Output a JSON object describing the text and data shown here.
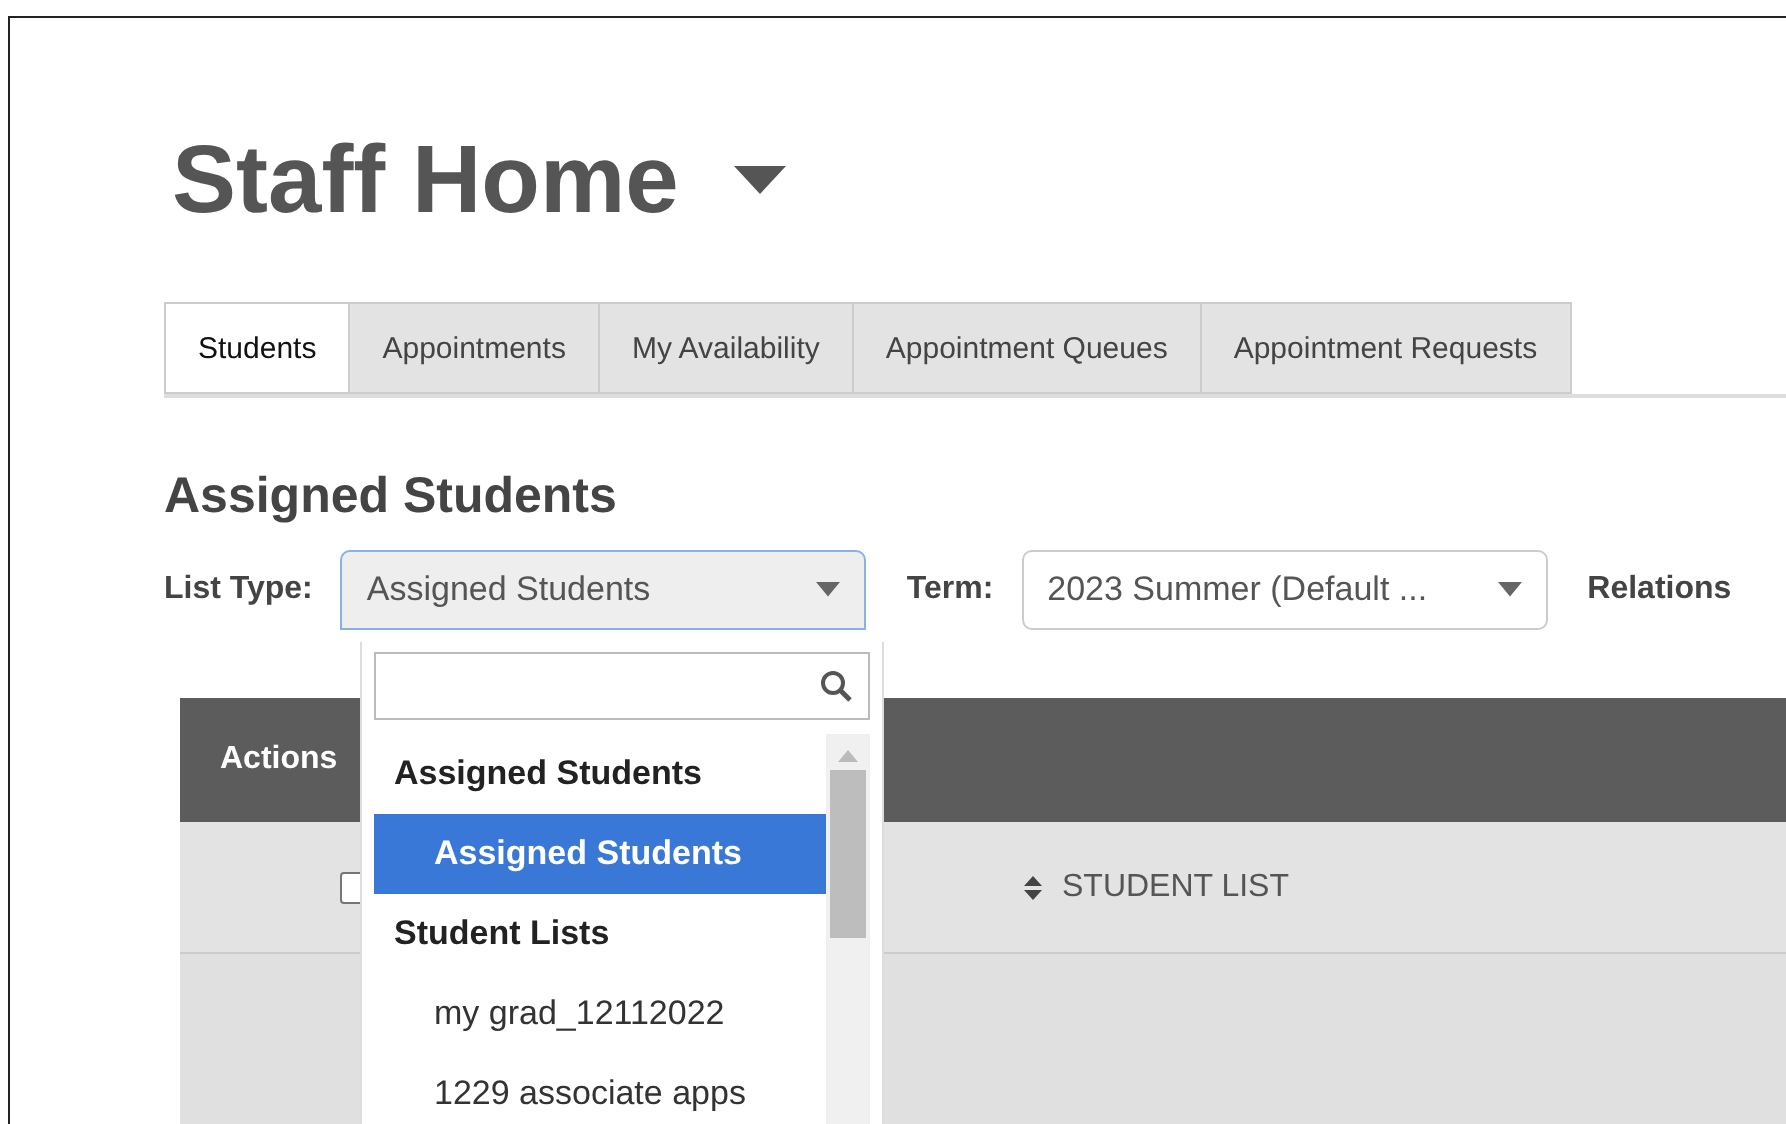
{
  "page_title": "Staff Home",
  "tabs": [
    {
      "label": "Students",
      "selected": true
    },
    {
      "label": "Appointments",
      "selected": false
    },
    {
      "label": "My Availability",
      "selected": false
    },
    {
      "label": "Appointment Queues",
      "selected": false
    },
    {
      "label": "Appointment Requests",
      "selected": false
    }
  ],
  "section_title": "Assigned Students",
  "filters": [
    {
      "label": "List Type:",
      "value": "Assigned Students",
      "open": true
    },
    {
      "label": "Term:",
      "value": "2023 Summer (Default ...",
      "open": false
    },
    {
      "label": "Relations"
    }
  ],
  "dropdown": {
    "groups": [
      {
        "label": "Assigned Students",
        "options": [
          {
            "label": "Assigned Students",
            "selected": true
          }
        ]
      },
      {
        "label": "Student Lists",
        "options": [
          {
            "label": "my grad_12112022",
            "selected": false
          },
          {
            "label": "1229 associate apps",
            "selected": false
          }
        ]
      }
    ]
  },
  "table": {
    "toolbar_label": "Actions",
    "select_all_checked": false,
    "columns": [
      "STUDENT LIST"
    ]
  }
}
